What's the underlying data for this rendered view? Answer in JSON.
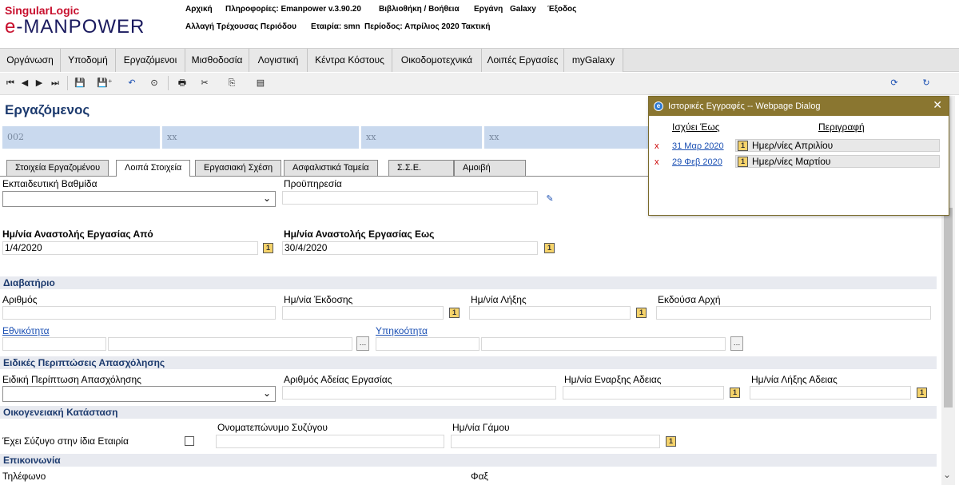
{
  "brand": {
    "line1": "SingularLogic",
    "logo_e": "e",
    "logo_rest": "-MANPOWER"
  },
  "header": {
    "links": [
      "Αρχική",
      "Πληροφορίες: Emanpower v.3.90.20",
      "Βιβλιοθήκη / Βοήθεια",
      "Εργάνη",
      "Galaxy",
      "Έξοδος"
    ],
    "line2": [
      "Αλλαγή Τρέχουσας Περιόδου",
      "Εταιρία: smn",
      "Περίοδος: Απρίλιος 2020 Τακτική"
    ]
  },
  "menu": [
    "Οργάνωση",
    "Υποδομή",
    "Εργαζόμενοι",
    "Μισθοδοσία",
    "Λογιστική",
    "Κέντρα Κόστους",
    "Οικοδομοτεχνικά",
    "Λοιπές Εργασίες",
    "myGalaxy"
  ],
  "page_title": "Εργαζόμενος",
  "info_values": [
    "002",
    "xx",
    "xx",
    "xx"
  ],
  "tabs": [
    "Στοιχεία Εργαζομένου",
    "Λοιπά Στοιχεία",
    "Εργασιακή Σχέση",
    "Ασφαλιστικά Ταμεία",
    "Σ.Σ.Ε.",
    "Αμοιβή"
  ],
  "fields": {
    "education": "Εκπαιδευτική Βαθμίδα",
    "prior_service": "Προϋπηρεσία",
    "suspension_from": "Ημ/νία Αναστολής Εργασίας Από",
    "suspension_from_value": "1/4/2020",
    "suspension_to": "Ημ/νία Αναστολής Εργασίας Εως",
    "suspension_to_value": "30/4/2020"
  },
  "passport": {
    "section": "Διαβατήριο",
    "number": "Αριθμός",
    "issue_date": "Ημ/νία Έκδοσης",
    "expiry_date": "Ημ/νία Λήξης",
    "authority": "Εκδούσα Αρχή",
    "nationality": "Εθνικότητα",
    "sub_nationality": "Υπηκοότητα"
  },
  "special": {
    "section": "Ειδικές Περιπτώσεις Απασχόλησης",
    "case": "Ειδική Περίπτωση Απασχόλησης",
    "permit_no": "Αριθμός Αδείας Εργασίας",
    "permit_start": "Ημ/νία Εναρξης Αδειας",
    "permit_end": "Ημ/νία Λήξης Αδειας"
  },
  "family": {
    "section": "Οικογενειακή Κατάσταση",
    "spouse_same_company": "Έχει Σύζυγο στην ίδια Εταιρία",
    "spouse_name": "Ονοματεπώνυμο Συζύγου",
    "marriage_date": "Ημ/νία Γάμου"
  },
  "contact": {
    "section": "Επικοινωνία",
    "phone": "Τηλέφωνο",
    "fax": "Φαξ"
  },
  "dialog": {
    "title": "Ιστορικές Εγγραφές -- Webpage Dialog",
    "col_valid": "Ισχύει Έως",
    "col_desc": "Περιγραφή",
    "rows": [
      {
        "x": "x",
        "date": "31 Μαρ 2020",
        "desc": "Ημερ/νίες Απριλίου"
      },
      {
        "x": "x",
        "date": "29 Φεβ 2020",
        "desc": "Ημερ/νίες Μαρτίου"
      }
    ]
  },
  "colors": {
    "title_blue": "#1c3a6e",
    "link_blue": "#1a4fb3",
    "brand_red": "#c8102e",
    "dialog_bar": "#8a7630"
  }
}
